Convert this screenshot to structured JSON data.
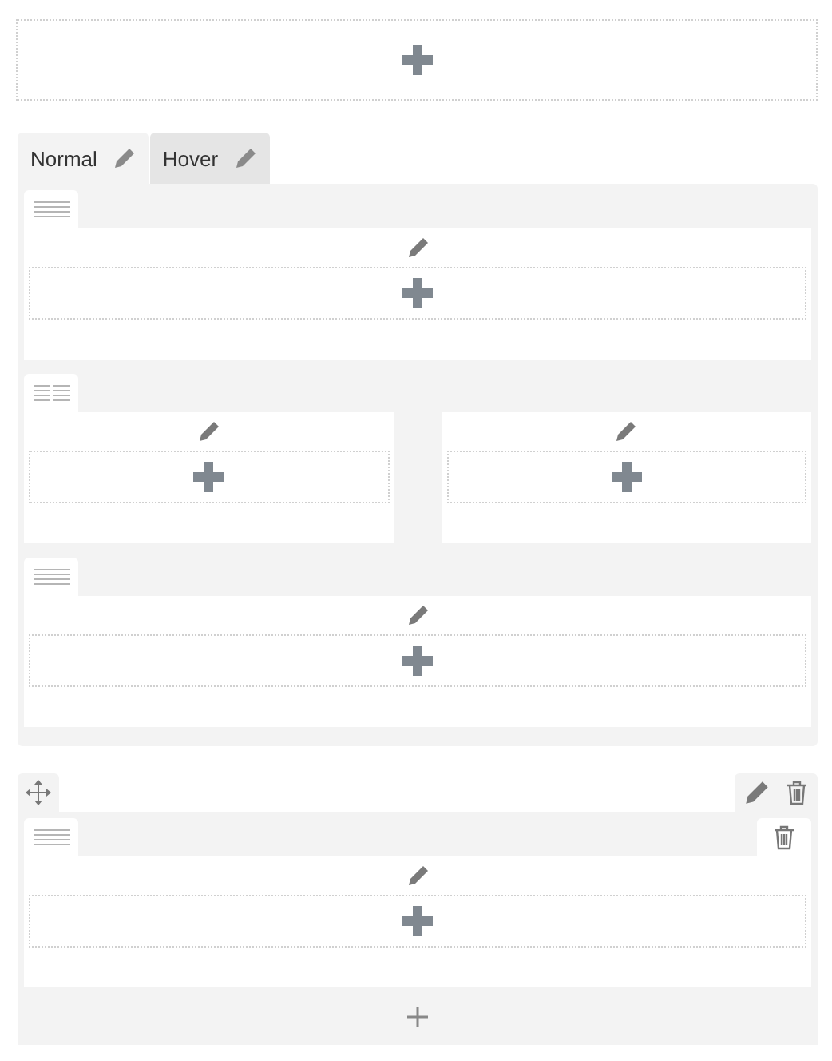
{
  "top_drop_zone": {
    "kind": "empty"
  },
  "sections": [
    {
      "kind": "tabbed",
      "tabs": [
        {
          "label": "Normal",
          "selected": true
        },
        {
          "label": "Hover",
          "selected": false
        }
      ],
      "rows": [
        {
          "kind": "one-column",
          "deletable": false,
          "columns": [
            {
              "kind": "empty"
            }
          ]
        },
        {
          "kind": "two-column",
          "deletable": false,
          "columns": [
            {
              "kind": "empty"
            },
            {
              "kind": "empty"
            }
          ]
        },
        {
          "kind": "one-column",
          "deletable": false,
          "columns": [
            {
              "kind": "empty"
            }
          ]
        }
      ]
    },
    {
      "kind": "movable",
      "rows": [
        {
          "kind": "one-column",
          "deletable": true,
          "columns": [
            {
              "kind": "empty"
            }
          ]
        }
      ]
    }
  ]
}
